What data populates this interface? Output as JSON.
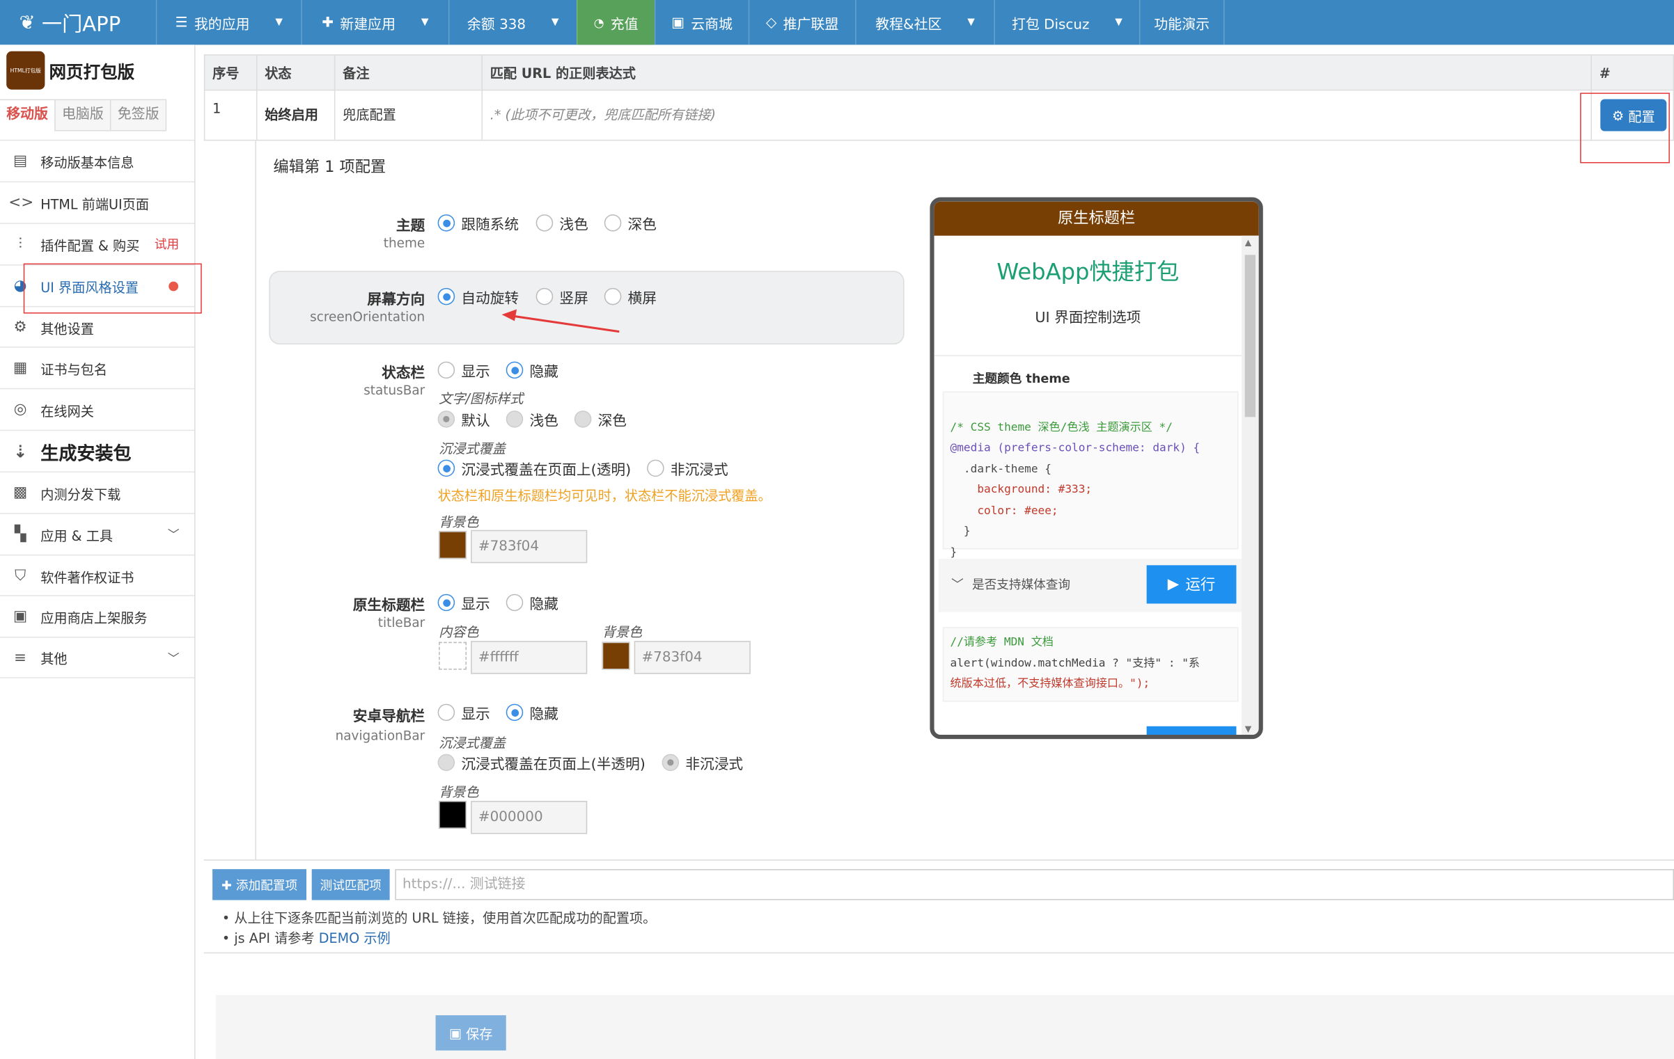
{
  "topnav": {
    "logo": "一门APP",
    "items": [
      {
        "label": "我的应用",
        "icon": "list-icon"
      },
      {
        "label": "新建应用",
        "icon": "plus-icon"
      },
      {
        "label": "余额 338"
      },
      {
        "label": "充值",
        "icon": "recharge-icon"
      },
      {
        "label": "云商城",
        "icon": "store-icon"
      },
      {
        "label": "推广联盟",
        "icon": "diamond-icon"
      },
      {
        "label": "教程&社区"
      },
      {
        "label": "打包 Discuz"
      },
      {
        "label": "功能演示"
      }
    ]
  },
  "sidebar": {
    "brand_badge": "HTML打包版",
    "brand_name": "网页打包版",
    "tabs": [
      "移动版",
      "电脑版",
      "免签版"
    ],
    "items": [
      {
        "label": "移动版基本信息",
        "icon": "document-list-icon"
      },
      {
        "label": "HTML 前端UI页面",
        "icon": "code-icon"
      },
      {
        "label": "插件配置 & 购买",
        "icon": "sliders-icon",
        "badge": "试用"
      },
      {
        "label": "UI 界面风格设置",
        "icon": "palette-icon"
      },
      {
        "label": "其他设置",
        "icon": "gear-icon"
      },
      {
        "label": "证书与包名",
        "icon": "certificate-icon"
      },
      {
        "label": "在线网关",
        "icon": "gateway-icon"
      },
      {
        "label": "生成安装包",
        "icon": "sort-numeric-icon"
      },
      {
        "label": "内测分发下载",
        "icon": "qrcode-icon"
      },
      {
        "label": "应用 & 工具",
        "icon": "apps-icon"
      },
      {
        "label": "软件著作权证书",
        "icon": "shield-icon"
      },
      {
        "label": "应用商店上架服务",
        "icon": "app-store-icon"
      },
      {
        "label": "其他",
        "icon": "menu-icon"
      }
    ]
  },
  "table": {
    "headers": [
      "序号",
      "状态",
      "备注",
      "匹配 URL 的正则表达式",
      "#"
    ],
    "row": {
      "index": "1",
      "status": "始终启用",
      "remark": "兜底配置",
      "regex": ".* (此项不可更改，兜底匹配所有链接)"
    },
    "config_button": "配置"
  },
  "form": {
    "edit_title": "编辑第 1 项配置",
    "theme": {
      "label": "主题",
      "sub": "theme",
      "options": [
        "跟随系统",
        "浅色",
        "深色"
      ],
      "selected": "跟随系统"
    },
    "orientation": {
      "label": "屏幕方向",
      "sub": "screenOrientation",
      "options": [
        "自动旋转",
        "竖屏",
        "横屏"
      ],
      "selected": "自动旋转"
    },
    "statusbar": {
      "label": "状态栏",
      "sub": "statusBar",
      "options": [
        "显示",
        "隐藏"
      ],
      "selected": "隐藏",
      "text_style_label": "文字/图标样式",
      "text_style_options": [
        "默认",
        "浅色",
        "深色"
      ],
      "immersive_label": "沉浸式覆盖",
      "immersive_options": [
        "沉浸式覆盖在页面上(透明)",
        "非沉浸式"
      ],
      "warning": "状态栏和原生标题栏均可见时，状态栏不能沉浸式覆盖。",
      "bg_label": "背景色",
      "bg_value": "#783f04"
    },
    "titlebar": {
      "label": "原生标题栏",
      "sub": "titleBar",
      "options": [
        "显示",
        "隐藏"
      ],
      "selected": "显示",
      "content_color_label": "内容色",
      "content_color": "#ffffff",
      "bg_label": "背景色",
      "bg_value": "#783f04"
    },
    "navbar": {
      "label": "安卓导航栏",
      "sub": "navigationBar",
      "options": [
        "显示",
        "隐藏"
      ],
      "selected": "隐藏",
      "immersive_label": "沉浸式覆盖",
      "immersive_options": [
        "沉浸式覆盖在页面上(半透明)",
        "非沉浸式"
      ],
      "bg_label": "背景色",
      "bg_value": "#000000"
    }
  },
  "phone": {
    "titlebar": "原生标题栏",
    "heading": "WebApp快捷打包",
    "subheading": "UI 界面控制选项",
    "section": "主题颜色 theme",
    "code_lines": [
      "/* CSS theme 深色/色浅 主题演示区 */",
      "@media (prefers-color-scheme: dark) {",
      "  .dark-theme {",
      "    background: #333;",
      "    color: #eee;",
      "  }",
      "}"
    ],
    "media_query_label": "是否支持媒体查询",
    "run_button": "运行",
    "comment_line": "//请参考 MDN 文档",
    "alert_line1": "alert(window.matchMedia ? \"支持\" : \"系",
    "alert_line2": "统版本过低，不支持媒体查询接口。\");"
  },
  "bottom": {
    "add_button": "添加配置项",
    "test_button": "测试匹配项",
    "test_placeholder": "https://... 测试链接",
    "note1": "从上往下逐条匹配当前浏览的 URL 链接，使用首次匹配成功的配置项。",
    "note2_prefix": "js API 请参考",
    "note2_link": "DEMO 示例",
    "save_button": "保存"
  },
  "colors": {
    "nav": "#3a87c2",
    "brown": "#783f04",
    "accent": "#2f7dc4",
    "warning": "#f0a020"
  }
}
